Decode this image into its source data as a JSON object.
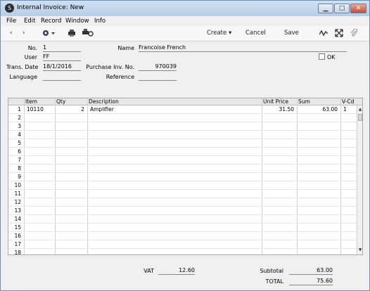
{
  "window": {
    "title": "Internal Invoice: New",
    "app_icon": "S"
  },
  "menu": [
    "File",
    "Edit",
    "Record",
    "Window",
    "Info"
  ],
  "toolbar": {
    "nav_prev": "‹",
    "nav_next": "›",
    "create": "Create",
    "cancel": "Cancel",
    "save": "Save"
  },
  "form": {
    "no_label": "No.",
    "no_value": "1",
    "user_label": "User",
    "user_value": "FF",
    "trans_date_label": "Trans. Date",
    "trans_date_value": "18/1/2016",
    "language_label": "Language",
    "language_value": "",
    "name_label": "Name",
    "name_value": "Francoise French",
    "purchase_label": "Purchase Inv. No.",
    "purchase_value": "970039",
    "reference_label": "Reference",
    "reference_value": "",
    "ok_label": "OK"
  },
  "grid": {
    "headers": [
      "Item",
      "Qty",
      "Description",
      "Unit Price",
      "Sum",
      "V-Cd"
    ],
    "rows": [
      {
        "n": "1",
        "item": "10110",
        "qty": "2",
        "desc": "Amplifier",
        "price": "31.50",
        "sum": "63.00",
        "vcd": "1"
      },
      {
        "n": "2",
        "item": "",
        "qty": "",
        "desc": "",
        "price": "",
        "sum": "",
        "vcd": ""
      },
      {
        "n": "3",
        "item": "",
        "qty": "",
        "desc": "",
        "price": "",
        "sum": "",
        "vcd": ""
      },
      {
        "n": "4",
        "item": "",
        "qty": "",
        "desc": "",
        "price": "",
        "sum": "",
        "vcd": ""
      },
      {
        "n": "5",
        "item": "",
        "qty": "",
        "desc": "",
        "price": "",
        "sum": "",
        "vcd": ""
      },
      {
        "n": "6",
        "item": "",
        "qty": "",
        "desc": "",
        "price": "",
        "sum": "",
        "vcd": ""
      },
      {
        "n": "7",
        "item": "",
        "qty": "",
        "desc": "",
        "price": "",
        "sum": "",
        "vcd": ""
      },
      {
        "n": "8",
        "item": "",
        "qty": "",
        "desc": "",
        "price": "",
        "sum": "",
        "vcd": ""
      },
      {
        "n": "9",
        "item": "",
        "qty": "",
        "desc": "",
        "price": "",
        "sum": "",
        "vcd": ""
      },
      {
        "n": "10",
        "item": "",
        "qty": "",
        "desc": "",
        "price": "",
        "sum": "",
        "vcd": ""
      },
      {
        "n": "11",
        "item": "",
        "qty": "",
        "desc": "",
        "price": "",
        "sum": "",
        "vcd": ""
      },
      {
        "n": "12",
        "item": "",
        "qty": "",
        "desc": "",
        "price": "",
        "sum": "",
        "vcd": ""
      },
      {
        "n": "13",
        "item": "",
        "qty": "",
        "desc": "",
        "price": "",
        "sum": "",
        "vcd": ""
      },
      {
        "n": "14",
        "item": "",
        "qty": "",
        "desc": "",
        "price": "",
        "sum": "",
        "vcd": ""
      },
      {
        "n": "15",
        "item": "",
        "qty": "",
        "desc": "",
        "price": "",
        "sum": "",
        "vcd": ""
      },
      {
        "n": "16",
        "item": "",
        "qty": "",
        "desc": "",
        "price": "",
        "sum": "",
        "vcd": ""
      },
      {
        "n": "17",
        "item": "",
        "qty": "",
        "desc": "",
        "price": "",
        "sum": "",
        "vcd": ""
      },
      {
        "n": "18",
        "item": "",
        "qty": "",
        "desc": "",
        "price": "",
        "sum": "",
        "vcd": ""
      }
    ]
  },
  "totals": {
    "vat_label": "VAT",
    "vat_value": "12.60",
    "subtotal_label": "Subtotal",
    "subtotal_value": "63.00",
    "total_label": "TOTAL",
    "total_value": "75.60"
  }
}
